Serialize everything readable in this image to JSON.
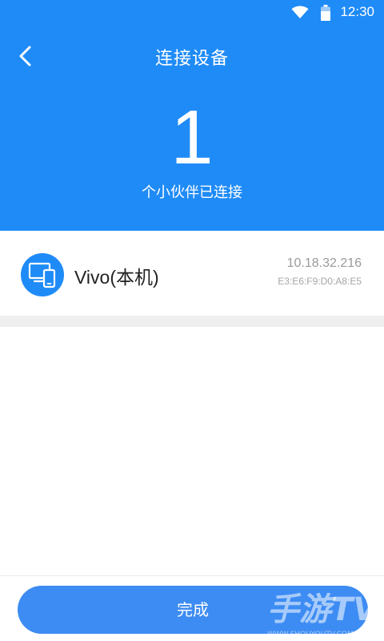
{
  "status_bar": {
    "time": "12:30",
    "icons": [
      "wifi-icon",
      "battery-icon"
    ]
  },
  "header": {
    "back_icon": "back-arrow-icon",
    "title": "连接设备",
    "count": "1",
    "count_caption": "个小伙伴已连接"
  },
  "devices": [
    {
      "icon": "devices-icon",
      "name": "Vivo(本机)",
      "ip": "10.18.32.216",
      "mac": "E3:E6:F9:D0:A8:E5"
    }
  ],
  "footer": {
    "done_label": "完成"
  },
  "watermark": {
    "text": "手游TV",
    "subtext": "WWW.SHOUYOUTV.COM"
  },
  "colors": {
    "primary": "#1f8bf7",
    "button": "#3d8cf3",
    "divider": "#efefef"
  }
}
